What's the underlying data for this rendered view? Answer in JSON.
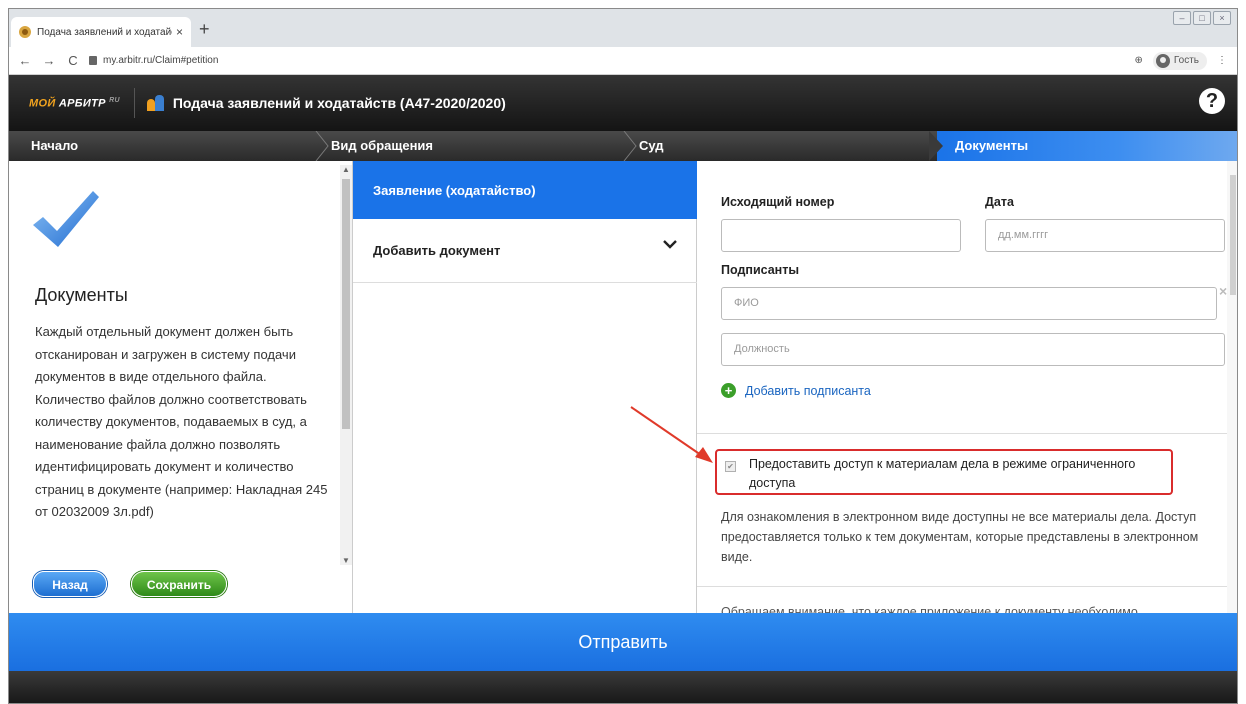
{
  "browser": {
    "tab_title": "Подача заявлений и ходатайств",
    "tab_close": "×",
    "new_tab": "+",
    "url": "my.arbitr.ru/Claim#petition",
    "guest_label": "Гость",
    "nav_back": "←",
    "nav_forward": "→",
    "reload": "C",
    "zoom_icon": "⊕",
    "menu": "⋮"
  },
  "app": {
    "logo_moi": "МОЙ",
    "logo_arbitr": " АРБИТР",
    "logo_ru": "RU",
    "title": "Подача заявлений и ходатайств (А47-2020/2020)",
    "help": "?"
  },
  "steps": {
    "items": [
      "Начало",
      "Вид обращения",
      "Суд",
      "Документы"
    ],
    "active_index": 3
  },
  "left": {
    "title": "Документы",
    "description": "Каждый отдельный документ должен быть отсканирован и загружен в систему подачи документов в виде отдельного файла. Количество файлов должно соответствовать количеству документов, подаваемых в суд, а наименование файла должно позволять идентифицировать документ и количество страниц в документе (например: Накладная 245 от 02032009 3л.pdf)",
    "back_button": "Назад",
    "save_button": "Сохранить"
  },
  "middle": {
    "active_item": "Заявление (ходатайство)",
    "add_document": "Добавить документ"
  },
  "right": {
    "outgoing_number_label": "Исходящий номер",
    "outgoing_number_value": "",
    "date_label": "Дата",
    "date_placeholder": "дд.мм.гггг",
    "signers_label": "Подписанты",
    "fio_placeholder": "ФИО",
    "position_placeholder": "Должность",
    "clear": "×",
    "add_signer": "Добавить подписанта",
    "restricted_access_label": "Предоставить доступ к материалам дела в режиме ограниченного доступа",
    "restricted_access_checked": true,
    "info_text": "Для ознакомления в электронном виде доступны не все материалы дела. Доступ предоставляется только к тем документам, которые представлены в электронном виде.",
    "note_text": "Обращаем внимание, что каждое приложение к документу необходимо"
  },
  "footer": {
    "submit": "Отправить"
  },
  "colors": {
    "accent_blue": "#1a73e8",
    "highlight_red": "#d92c2c",
    "save_green": "#3b9f2a"
  }
}
